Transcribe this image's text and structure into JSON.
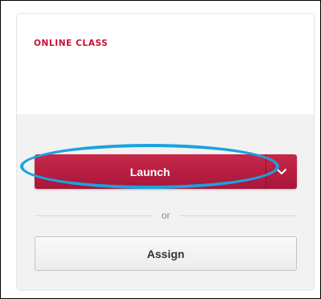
{
  "card": {
    "label": "ONLINE CLASS"
  },
  "actions": {
    "launch_label": "Launch",
    "launch_dropdown_icon": "chevron-down-icon",
    "separator_text": "or",
    "assign_label": "Assign"
  },
  "colors": {
    "brand": "#c8102e",
    "launch_button": "#b81e40",
    "highlight_ring": "#1aa3e0",
    "card_footer_bg": "#f2f2f2"
  }
}
